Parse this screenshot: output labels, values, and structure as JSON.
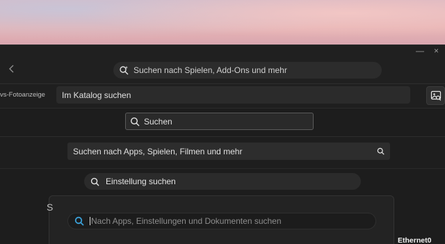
{
  "store": {
    "search_placeholder": "Suchen nach Spielen, Add-Ons und mehr",
    "window_controls": [
      "—",
      "×"
    ]
  },
  "photos": {
    "app_label": "vs-Fotoanzeige",
    "catalog_search": "Im Katalog suchen"
  },
  "explorer": {
    "search_placeholder": "Suchen"
  },
  "ms_store_apps": {
    "search_placeholder": "Suchen nach Apps, Spielen, Filmen und mehr"
  },
  "settings": {
    "search_placeholder": "Einstellung suchen"
  },
  "start_menu": {
    "search_placeholder": "Nach Apps, Einstellungen und Dokumenten suchen"
  },
  "taskbar": {
    "network_label": "Ethernet0"
  },
  "colors": {
    "accent": "#3aa0d8",
    "background": "#1c1c1c"
  }
}
